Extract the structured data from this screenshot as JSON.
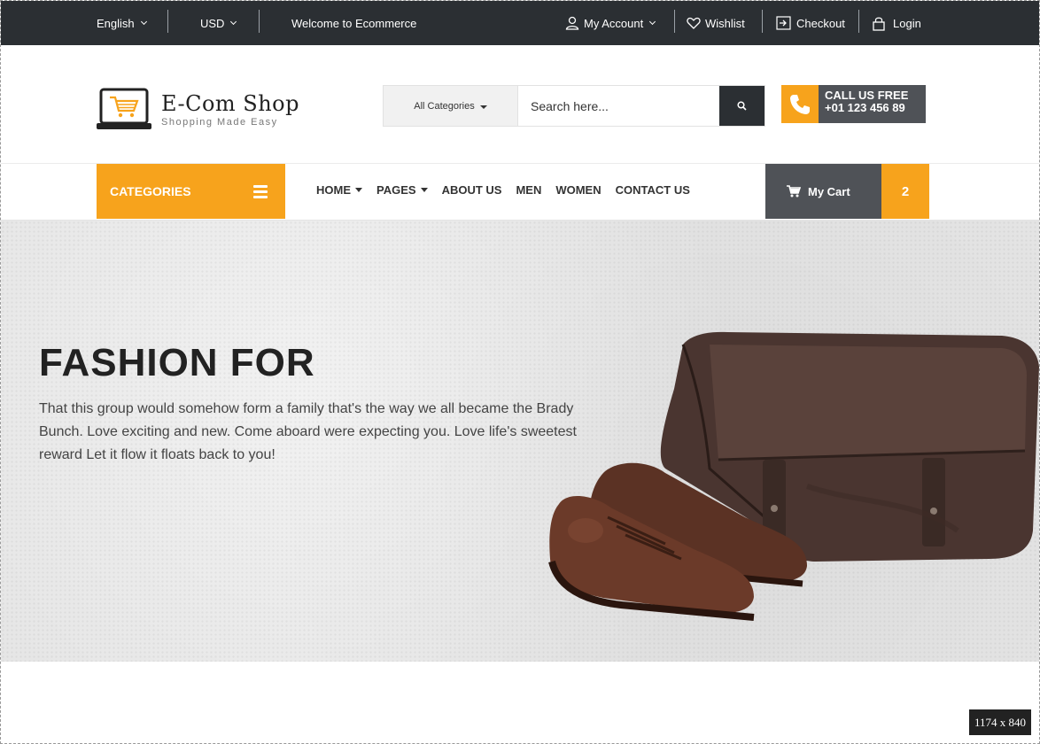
{
  "topbar": {
    "language": "English",
    "currency": "USD",
    "welcome": "Welcome to Ecommerce",
    "my_account": "My Account",
    "wishlist": "Wishlist",
    "checkout": "Checkout",
    "login": "Login"
  },
  "header": {
    "logo_name": "E-Com Shop",
    "logo_tagline": "Shopping Made Easy",
    "search_category": "All Categories",
    "search_placeholder": "Search here...",
    "call_label": "CALL US FREE",
    "call_number": "+01 123 456 89"
  },
  "nav": {
    "categories_label": "CATEGORIES",
    "items": [
      "HOME",
      "PAGES",
      "ABOUT US",
      "MEN",
      "WOMEN",
      "CONTACT US"
    ],
    "cart_label": "My Cart",
    "cart_count": "2"
  },
  "hero": {
    "title": "FASHION FOR",
    "description": "That this group would somehow form a family that's the way we all became the Brady Bunch. Love exciting and new. Come aboard were expecting you. Love life's sweetest reward Let it flow it floats back to you!"
  },
  "badge": "1174 x 840",
  "colors": {
    "accent": "#f7a31c",
    "dark": "#2b2f33",
    "slate": "#4f5257"
  }
}
